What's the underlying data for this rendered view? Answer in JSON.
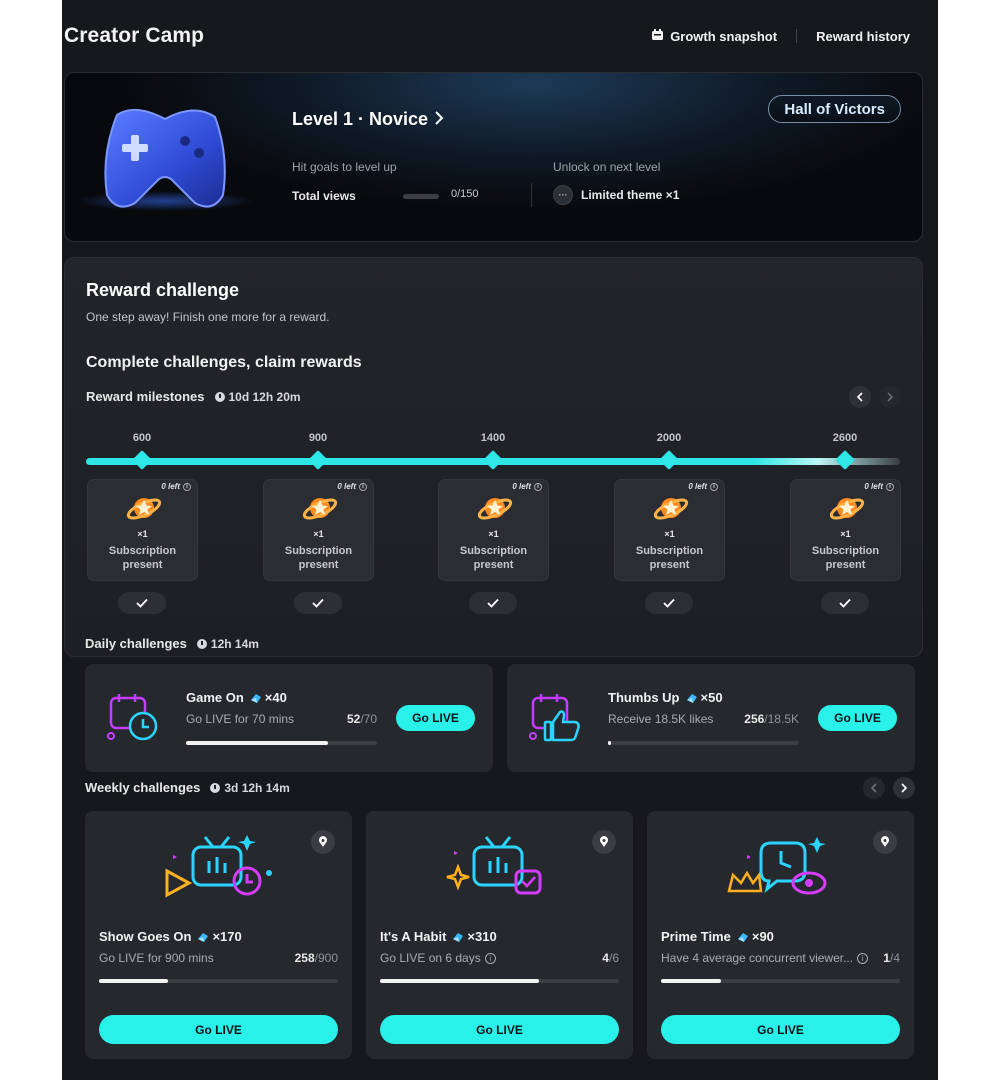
{
  "header": {
    "title": "Creator Camp",
    "growth_snapshot": "Growth snapshot",
    "reward_history": "Reward history"
  },
  "level": {
    "title": "Level 1 · Novice",
    "hit_goals": "Hit goals to level up",
    "total_views_label": "Total views",
    "total_views_value": "0/150",
    "total_views_progress": 0,
    "unlock_label": "Unlock on next level",
    "unlock_item": "Limited theme ×1",
    "unlock_icon_text": "···",
    "hall_button": "Hall of Victors"
  },
  "reward_challenge": {
    "title": "Reward challenge",
    "subtitle": "One step away! Finish one more for a reward.",
    "section_title": "Complete challenges, claim rewards",
    "milestones_label": "Reward milestones",
    "milestones_timer": "10d 12h 20m",
    "milestones": [
      {
        "points": "600",
        "left": "0 left",
        "qty": "×1",
        "name": "Subscription present"
      },
      {
        "points": "900",
        "left": "0 left",
        "qty": "×1",
        "name": "Subscription present"
      },
      {
        "points": "1400",
        "left": "0 left",
        "qty": "×1",
        "name": "Subscription present"
      },
      {
        "points": "2000",
        "left": "0 left",
        "qty": "×1",
        "name": "Subscription present"
      },
      {
        "points": "2600",
        "left": "0 left",
        "qty": "×1",
        "name": "Subscription present"
      }
    ]
  },
  "daily": {
    "label": "Daily challenges",
    "timer": "12h 14m",
    "cards": [
      {
        "title": "Game On",
        "points": "×40",
        "desc": "Go LIVE for 70 mins",
        "done": "52",
        "total": "/70",
        "progress": 0.743,
        "button": "Go LIVE"
      },
      {
        "title": "Thumbs Up",
        "points": "×50",
        "desc": "Receive 18.5K likes",
        "done": "256",
        "total": "/18.5K",
        "progress": 0.014,
        "button": "Go LIVE"
      }
    ]
  },
  "weekly": {
    "label": "Weekly challenges",
    "timer": "3d 12h 14m",
    "cards": [
      {
        "title": "Show Goes On",
        "points": "×170",
        "desc": "Go LIVE for 900 mins",
        "done": "258",
        "total": "/900",
        "progress": 0.287,
        "button": "Go LIVE"
      },
      {
        "title": "It's A Habit",
        "points": "×310",
        "desc": "Go LIVE on 6 days",
        "done": "4",
        "total": "/6",
        "progress": 0.667,
        "button": "Go LIVE"
      },
      {
        "title": "Prime Time",
        "points": "×90",
        "desc": "Have 4 average concurrent viewer...",
        "done": "1",
        "total": "/4",
        "progress": 0.25,
        "button": "Go LIVE"
      }
    ]
  },
  "colors": {
    "accent": "#2af0ea",
    "background": "#16181b",
    "card": "#25282d"
  }
}
